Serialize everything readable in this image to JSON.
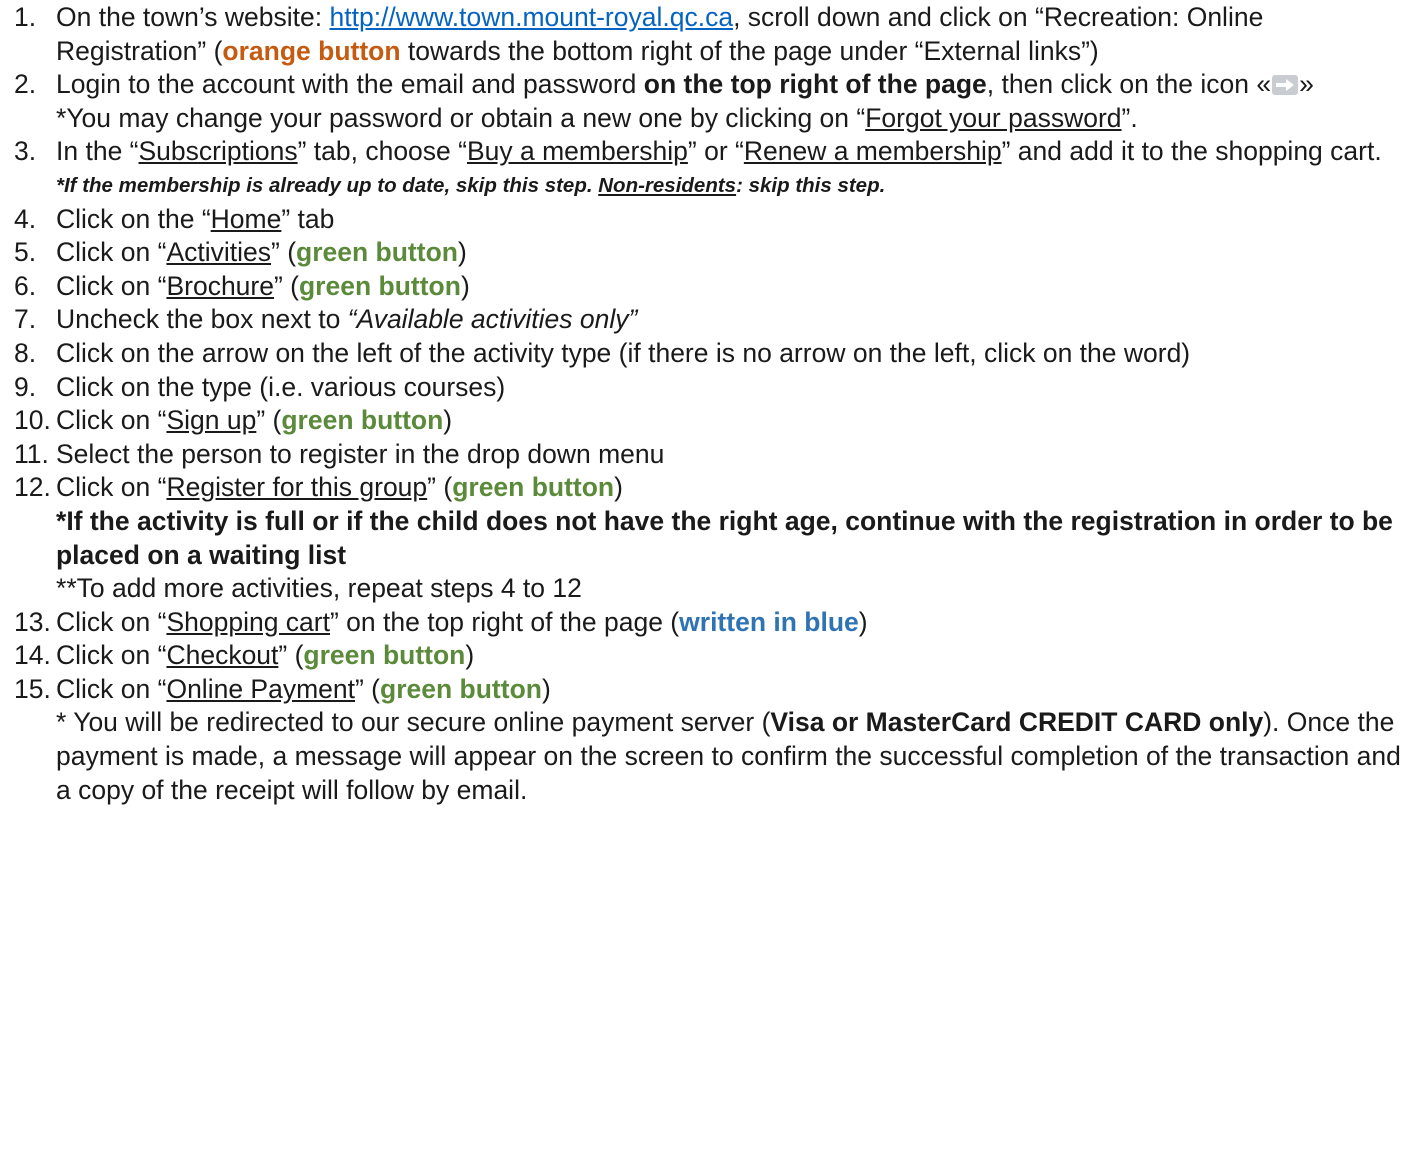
{
  "steps": [
    {
      "num": "1.",
      "a": "On the town’s website: ",
      "link": "http://www.town.mount-royal.qc.ca",
      "b": ", scroll down and click on “Recreation: Online Registration” (",
      "hl": "orange button",
      "c": " towards the bottom right of the page under “External links”)"
    },
    {
      "num": "2.",
      "a": "Login to the account with the email and password ",
      "bold": "on the top right of the page",
      "b": ", then click on the icon «",
      "c": "»",
      "note_a": "*You may change your password or obtain a new one by clicking on “",
      "note_u": "Forgot your password",
      "note_b": "”."
    },
    {
      "num": "3.",
      "a": "In the “",
      "u1": "Subscriptions",
      "b": "” tab, choose “",
      "u2": "Buy a membership",
      "c": "” or “",
      "u3": "Renew a membership",
      "d": "” and add it to the shopping cart.",
      "note_a": "*If the membership is already up to date, skip this step. ",
      "note_u": "Non-residents",
      "note_b": ": skip this step."
    },
    {
      "num": "4.",
      "a": "Click on the “",
      "u": "Home",
      "b": "” tab"
    },
    {
      "num": "5.",
      "a": "Click on “",
      "u": "Activities",
      "b": "” (",
      "g": "green button",
      "c": ")"
    },
    {
      "num": "6.",
      "a": "Click on “",
      "u": "Brochure",
      "b": "” (",
      "g": "green button",
      "c": ")"
    },
    {
      "num": "7.",
      "a": "Uncheck the box next to ",
      "i": "“Available activities only”"
    },
    {
      "num": "8.",
      "a": "Click on the arrow on the left of the activity type (if there is no arrow on the left, click on the word)"
    },
    {
      "num": "9.",
      "a": "Click on the type (i.e. various courses)"
    },
    {
      "num": "10.",
      "a": "Click on “",
      "u": "Sign up",
      "b": "” (",
      "g": "green button",
      "c": ")"
    },
    {
      "num": "11.",
      "a": "Select the person to register in the drop down menu"
    },
    {
      "num": "12.",
      "a": "Click on “",
      "u": "Register for this group",
      "b": "” (",
      "g": "green button",
      "c": ")",
      "note_bold": "*If the activity is full or if the child does not have the right age, continue with the registration in order to be placed on a waiting list",
      "note2": "**To add more activities, repeat steps 4 to 12"
    },
    {
      "num": "13.",
      "a": "Click on “",
      "u": "Shopping cart",
      "b": "” on the top right of the page (",
      "bl": "written in blue",
      "c": ")"
    },
    {
      "num": "14.",
      "a": "Click on “",
      "u": "Checkout",
      "b": "” (",
      "g": "green button",
      "c": ")"
    },
    {
      "num": "15.",
      "a": "Click on “",
      "u": "Online Payment",
      "b": "” (",
      "g": "green button",
      "c": ")",
      "note_a": "* You will be redirected to our secure online payment server (",
      "note_bold": "Visa or MasterCard CREDIT CARD only",
      "note_b": "). Once the payment is made, a message will appear on the screen to confirm the successful completion of the transaction and a copy of the receipt will follow by email."
    }
  ],
  "icons": {
    "login_icon": "arrow-right-icon"
  },
  "colors": {
    "link": "#0563c1",
    "green": "#5b8a3a",
    "orange": "#c55a11",
    "blue": "#2e74b5"
  }
}
